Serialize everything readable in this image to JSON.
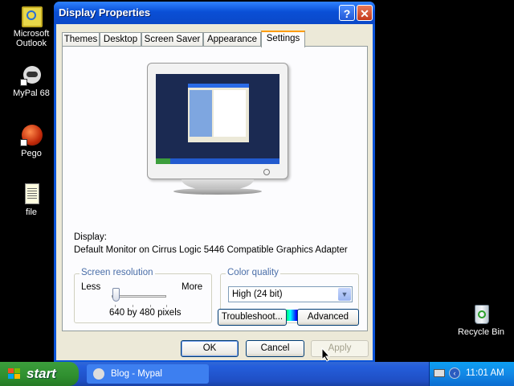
{
  "desktop": {
    "icons": [
      {
        "label": "Microsoft Outlook",
        "icon": "outlook-icon"
      },
      {
        "label": "MyPal 68",
        "icon": "mypal-icon"
      },
      {
        "label": "Pego",
        "icon": "pego-icon"
      },
      {
        "label": "file",
        "icon": "document-icon"
      },
      {
        "label": "Recycle Bin",
        "icon": "recycle-bin-icon"
      }
    ]
  },
  "window": {
    "title": "Display Properties",
    "help_glyph": "?",
    "close_glyph": "✕",
    "tabs": [
      {
        "label": "Themes",
        "active": false
      },
      {
        "label": "Desktop",
        "active": false
      },
      {
        "label": "Screen Saver",
        "active": false
      },
      {
        "label": "Appearance",
        "active": false
      },
      {
        "label": "Settings",
        "active": true
      }
    ],
    "settings": {
      "display_label": "Display:",
      "display_value": "Default Monitor on Cirrus Logic 5446 Compatible Graphics Adapter",
      "resolution": {
        "title": "Screen resolution",
        "less": "Less",
        "more": "More",
        "value": "640 by 480 pixels",
        "slider_position": 0
      },
      "color_quality": {
        "title": "Color quality",
        "selected": "High (24 bit)"
      },
      "troubleshoot_label": "Troubleshoot...",
      "advanced_label": "Advanced"
    },
    "ok_label": "OK",
    "cancel_label": "Cancel",
    "apply_label": "Apply"
  },
  "taskbar": {
    "start_label": "start",
    "items": [
      {
        "label": "Blog - Mypal",
        "icon": "mypal-icon"
      }
    ],
    "clock": "11:01 AM",
    "tray_chevron": "‹"
  },
  "colors": {
    "title_blue": "#0a53d8",
    "dialog_bg": "#ece9d8",
    "taskbar_blue": "#245edb",
    "start_green": "#3c9e3c"
  }
}
